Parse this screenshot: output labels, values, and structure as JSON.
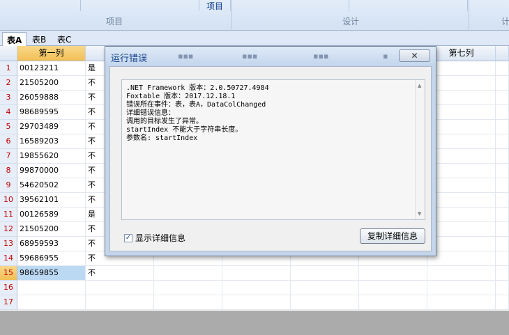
{
  "ribbon": {
    "header_label": "项目",
    "groups": [
      "项目",
      "设计",
      "计"
    ]
  },
  "sheet_tabs": [
    "表A",
    "表B",
    "表C"
  ],
  "grid": {
    "col1_header": "第一列",
    "col7_header": "第七列",
    "row_numbers": [
      "1",
      "2",
      "3",
      "4",
      "5",
      "6",
      "7",
      "8",
      "9",
      "10",
      "11",
      "12",
      "13",
      "14",
      "15",
      "16",
      "17"
    ],
    "col1_values": [
      "00123211",
      "21505200",
      "26059888",
      "98689595",
      "29703489",
      "16589203",
      "19855620",
      "99870000",
      "54620502",
      "39562101",
      "00126589",
      "21505200",
      "68959593",
      "59686955",
      "98659855",
      "",
      ""
    ],
    "col2_values": [
      "是",
      "不",
      "不",
      "不",
      "不",
      "不",
      "不",
      "不",
      "不",
      "不",
      "是",
      "不",
      "不",
      "不",
      "不",
      "",
      ""
    ]
  },
  "dialog": {
    "title": "运行错误",
    "close_label": "✕",
    "message_lines": [
      ".NET Framework 版本：2.0.50727.4984",
      "Foxtable 版本：2017.12.18.1",
      "错误所在事件：表，表A，DataColChanged",
      "详细错误信息：",
      "调用的目标发生了异常。",
      "startIndex 不能大于字符串长度。",
      "参数名: startIndex"
    ],
    "checkbox_label": "显示详细信息",
    "checkbox_checked": true,
    "copy_button_label": "复制详细信息"
  }
}
